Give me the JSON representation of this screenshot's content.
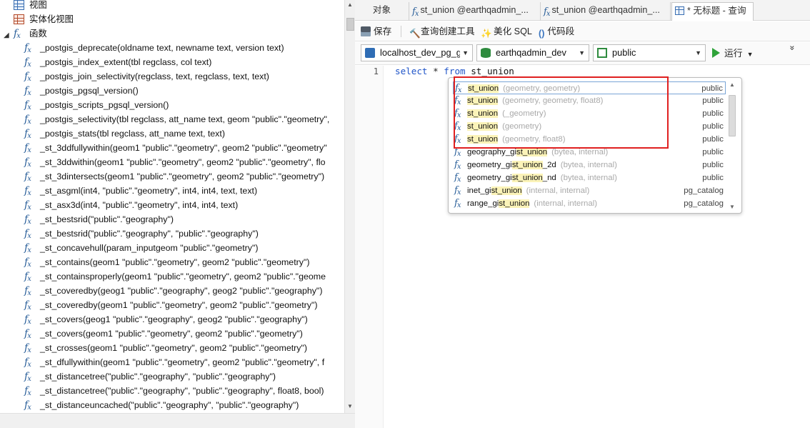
{
  "tree": {
    "views_label": "视图",
    "mviews_label": "实体化视图",
    "functions_label": "函数",
    "functions": [
      "_postgis_deprecate(oldname text, newname text, version text)",
      "_postgis_index_extent(tbl regclass, col text)",
      "_postgis_join_selectivity(regclass, text, regclass, text, text)",
      "_postgis_pgsql_version()",
      "_postgis_scripts_pgsql_version()",
      "_postgis_selectivity(tbl regclass, att_name text, geom \"public\".\"geometry\",",
      "_postgis_stats(tbl regclass, att_name text, text)",
      "_st_3ddfullywithin(geom1 \"public\".\"geometry\", geom2 \"public\".\"geometry\"",
      "_st_3ddwithin(geom1 \"public\".\"geometry\", geom2 \"public\".\"geometry\", flo",
      "_st_3dintersects(geom1 \"public\".\"geometry\", geom2 \"public\".\"geometry\")",
      "_st_asgml(int4, \"public\".\"geometry\", int4, int4, text, text)",
      "_st_asx3d(int4, \"public\".\"geometry\", int4, int4, text)",
      "_st_bestsrid(\"public\".\"geography\")",
      "_st_bestsrid(\"public\".\"geography\", \"public\".\"geography\")",
      "_st_concavehull(param_inputgeom \"public\".\"geometry\")",
      "_st_contains(geom1 \"public\".\"geometry\", geom2 \"public\".\"geometry\")",
      "_st_containsproperly(geom1 \"public\".\"geometry\", geom2 \"public\".\"geome",
      "_st_coveredby(geog1 \"public\".\"geography\", geog2 \"public\".\"geography\")",
      "_st_coveredby(geom1 \"public\".\"geometry\", geom2 \"public\".\"geometry\")",
      "_st_covers(geog1 \"public\".\"geography\", geog2 \"public\".\"geography\")",
      "_st_covers(geom1 \"public\".\"geometry\", geom2 \"public\".\"geometry\")",
      "_st_crosses(geom1 \"public\".\"geometry\", geom2 \"public\".\"geometry\")",
      "_st_dfullywithin(geom1 \"public\".\"geometry\", geom2 \"public\".\"geometry\", f",
      "_st_distancetree(\"public\".\"geography\", \"public\".\"geography\")",
      "_st_distancetree(\"public\".\"geography\", \"public\".\"geography\", float8, bool)",
      "_st_distanceuncached(\"public\".\"geography\", \"public\".\"geography\")"
    ]
  },
  "tabs": [
    {
      "label": "对象"
    },
    {
      "label": "st_union @earthqadmin_..."
    },
    {
      "label": "st_union @earthqadmin_..."
    },
    {
      "label": "* 无标题 - 查询"
    }
  ],
  "toolbar": {
    "save": "保存",
    "query_builder": "查询创建工具",
    "beautify": "美化 SQL",
    "snippet": "代码段",
    "snippet_glyph": "()"
  },
  "connection": {
    "connection": "localhost_dev_pg_gl",
    "database": "earthqadmin_dev",
    "schema": "public",
    "run": "运行",
    "more": "»"
  },
  "editor": {
    "line_number": "1",
    "kw_select": "select",
    "star": "*",
    "kw_from": "from",
    "identifier": "st_union"
  },
  "autocomplete": {
    "items": [
      {
        "pre": "",
        "hl": "st_union",
        "post": "",
        "args": "(geometry, geometry)",
        "schema": "public"
      },
      {
        "pre": "",
        "hl": "st_union",
        "post": "",
        "args": "(geometry, geometry, float8)",
        "schema": "public"
      },
      {
        "pre": "",
        "hl": "st_union",
        "post": "",
        "args": "(_geometry)",
        "schema": "public"
      },
      {
        "pre": "",
        "hl": "st_union",
        "post": "",
        "args": "(geometry)",
        "schema": "public"
      },
      {
        "pre": "",
        "hl": "st_union",
        "post": "",
        "args": "(geometry, float8)",
        "schema": "public"
      },
      {
        "pre": "geography_gi",
        "hl": "st_union",
        "post": "",
        "args": "(bytea, internal)",
        "schema": "public"
      },
      {
        "pre": "geometry_gi",
        "hl": "st_union",
        "post": "_2d",
        "args": "(bytea, internal)",
        "schema": "public"
      },
      {
        "pre": "geometry_gi",
        "hl": "st_union",
        "post": "_nd",
        "args": "(bytea, internal)",
        "schema": "public"
      },
      {
        "pre": "inet_gi",
        "hl": "st_union",
        "post": "",
        "args": "(internal, internal)",
        "schema": "pg_catalog"
      },
      {
        "pre": "range_gi",
        "hl": "st_union",
        "post": "",
        "args": "(internal, internal)",
        "schema": "pg_catalog"
      }
    ]
  },
  "colors": {
    "keyword": "#1f54c8",
    "fx_icon": "#2a5f9a",
    "highlight": "#fbf3b8",
    "annotation": "#e02020"
  }
}
